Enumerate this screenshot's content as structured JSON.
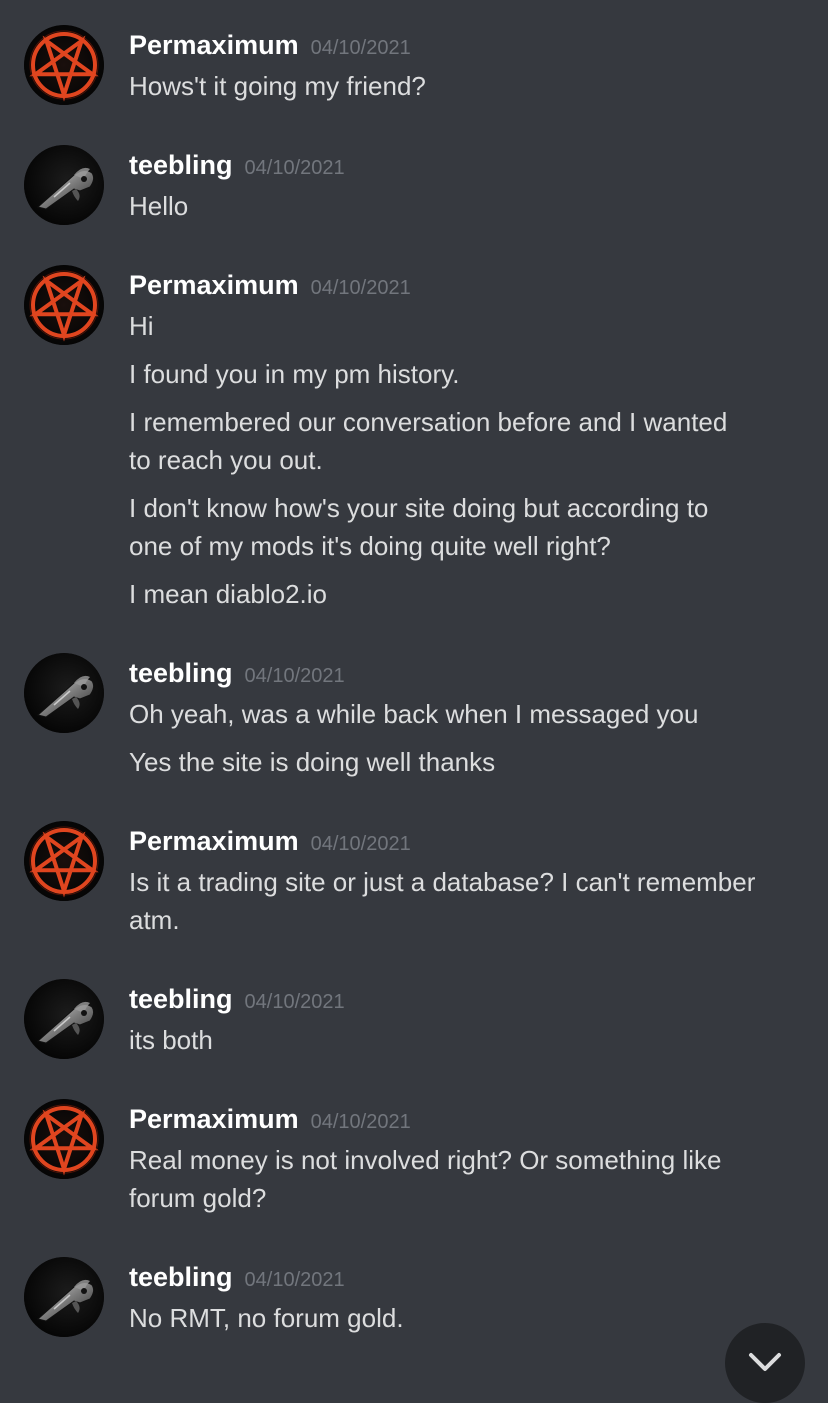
{
  "colors": {
    "background": "#36393f",
    "username": "#ffffff",
    "timestamp": "#72767d",
    "message_text": "#dcddde",
    "pentagram_accent": "#e0451f"
  },
  "messages": [
    {
      "author": "Permaximum",
      "avatar_icon": "pentagram-icon",
      "timestamp": "04/10/2021",
      "lines": [
        "Hows't it going my friend?"
      ]
    },
    {
      "author": "teebling",
      "avatar_icon": "raven-skull-icon",
      "timestamp": "04/10/2021",
      "lines": [
        "Hello"
      ]
    },
    {
      "author": "Permaximum",
      "avatar_icon": "pentagram-icon",
      "timestamp": "04/10/2021",
      "lines": [
        "Hi",
        "I found you in my pm history.",
        "I remembered our conversation before and I wanted",
        "to reach you out.",
        "I don't know how's your site doing but according to",
        "one of my mods it's doing quite well right?",
        "I mean diablo2.io"
      ]
    },
    {
      "author": "teebling",
      "avatar_icon": "raven-skull-icon",
      "timestamp": "04/10/2021",
      "lines": [
        "Oh yeah, was a while back when I messaged you",
        "Yes the site is doing well thanks"
      ]
    },
    {
      "author": "Permaximum",
      "avatar_icon": "pentagram-icon",
      "timestamp": "04/10/2021",
      "lines": [
        "Is it a trading site or just a database? I can't remember",
        "atm."
      ]
    },
    {
      "author": "teebling",
      "avatar_icon": "raven-skull-icon",
      "timestamp": "04/10/2021",
      "lines": [
        "its both"
      ]
    },
    {
      "author": "Permaximum",
      "avatar_icon": "pentagram-icon",
      "timestamp": "04/10/2021",
      "lines": [
        "Real money is not involved right? Or something like",
        "forum gold?"
      ]
    },
    {
      "author": "teebling",
      "avatar_icon": "raven-skull-icon",
      "timestamp": "04/10/2021",
      "lines": [
        "No RMT, no forum gold."
      ]
    }
  ],
  "scroll_button": {
    "icon": "chevron-down-icon"
  }
}
